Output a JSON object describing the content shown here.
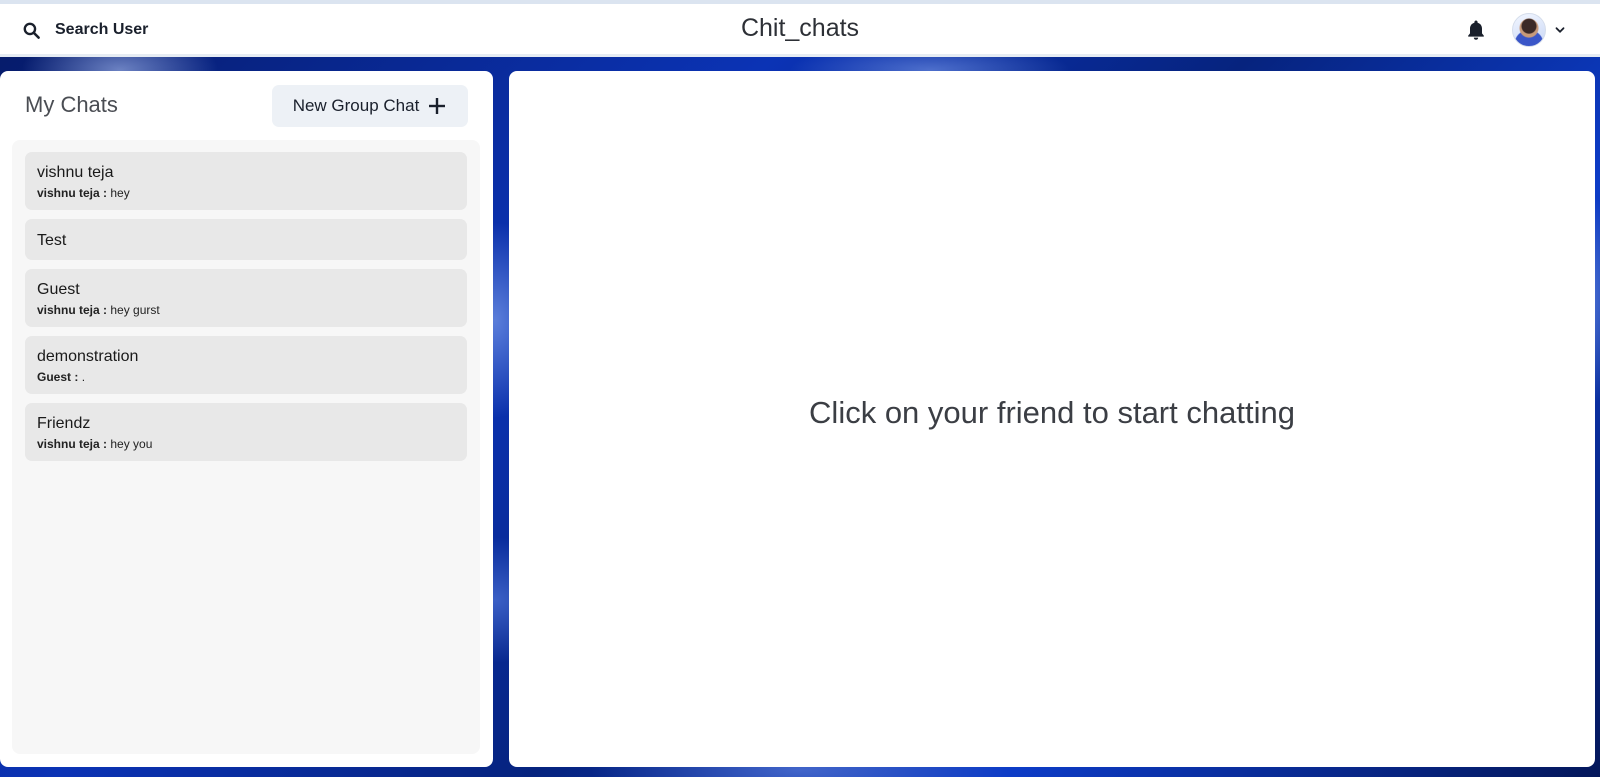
{
  "header": {
    "search_label": "Search User",
    "search_icon": "search-icon",
    "app_title": "Chit_chats",
    "notification_icon": "bell-icon",
    "profile_chevron_icon": "chevron-down-icon"
  },
  "sidebar": {
    "title": "My Chats",
    "new_group_label": "New Group Chat",
    "new_group_icon": "plus-icon",
    "chats": [
      {
        "name": "vishnu teja",
        "sender": "vishnu teja :",
        "message": "hey"
      },
      {
        "name": "Test",
        "sender": "",
        "message": ""
      },
      {
        "name": "Guest",
        "sender": "vishnu teja :",
        "message": "hey gurst"
      },
      {
        "name": "demonstration",
        "sender": "Guest :",
        "message": "."
      },
      {
        "name": "Friendz",
        "sender": "vishnu teja :",
        "message": "hey you"
      }
    ]
  },
  "main": {
    "placeholder": "Click on your friend to start chatting"
  },
  "colors": {
    "background_accent": "#0b33b5",
    "panel": "#ffffff",
    "chat_item": "#e8e8e8",
    "button_bg": "#edf1f6"
  }
}
